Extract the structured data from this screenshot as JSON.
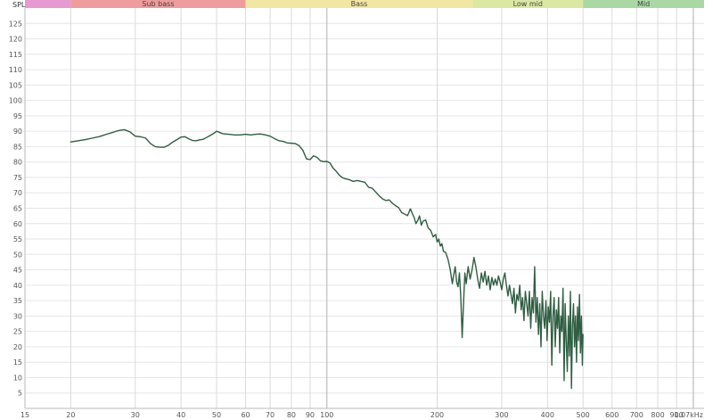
{
  "chart_data": {
    "type": "line",
    "y_axis_label": "SPL",
    "x_scale": "log",
    "xlim": [
      15,
      1070
    ],
    "ylim": [
      0,
      130
    ],
    "grid": true,
    "x_ticks": [
      {
        "value": 15,
        "label": "15"
      },
      {
        "value": 20,
        "label": "20"
      },
      {
        "value": 30,
        "label": "30"
      },
      {
        "value": 40,
        "label": "40"
      },
      {
        "value": 50,
        "label": "50"
      },
      {
        "value": 60,
        "label": "60"
      },
      {
        "value": 70,
        "label": "70"
      },
      {
        "value": 80,
        "label": "80"
      },
      {
        "value": 90,
        "label": "90"
      },
      {
        "value": 100,
        "label": "100"
      },
      {
        "value": 200,
        "label": "200"
      },
      {
        "value": 300,
        "label": "300"
      },
      {
        "value": 400,
        "label": "400"
      },
      {
        "value": 500,
        "label": "500"
      },
      {
        "value": 600,
        "label": "600"
      },
      {
        "value": 700,
        "label": "700"
      },
      {
        "value": 800,
        "label": "800"
      },
      {
        "value": 900,
        "label": "900"
      },
      {
        "value": 1070,
        "label": "1.07kHz"
      }
    ],
    "y_ticks": [
      5,
      10,
      15,
      20,
      25,
      30,
      35,
      40,
      45,
      50,
      55,
      60,
      65,
      70,
      75,
      80,
      85,
      90,
      95,
      100,
      105,
      110,
      115,
      120,
      125
    ],
    "bands": [
      {
        "label": "",
        "from": 15,
        "to": 20,
        "color": "#e79ad2"
      },
      {
        "label": "Sub bass",
        "from": 20,
        "to": 60,
        "color": "#ee9c9c"
      },
      {
        "label": "Bass",
        "from": 60,
        "to": 250,
        "color": "#f2e6a3"
      },
      {
        "label": "Low mid",
        "from": 250,
        "to": 500,
        "color": "#dbe8a3"
      },
      {
        "label": "Mid",
        "from": 500,
        "to": 1070,
        "color": "#a9d8a5"
      }
    ],
    "series": [
      {
        "line_color": "#2f5e42",
        "points": [
          [
            20,
            86.5
          ],
          [
            21,
            86.9
          ],
          [
            22,
            87.3
          ],
          [
            23,
            87.8
          ],
          [
            24,
            88.3
          ],
          [
            25,
            89.0
          ],
          [
            26,
            89.6
          ],
          [
            27,
            90.2
          ],
          [
            28,
            90.5
          ],
          [
            29,
            89.8
          ],
          [
            30,
            88.4
          ],
          [
            31,
            88.2
          ],
          [
            32,
            87.8
          ],
          [
            33,
            86.0
          ],
          [
            34,
            85.0
          ],
          [
            35,
            84.8
          ],
          [
            36,
            84.8
          ],
          [
            37,
            85.5
          ],
          [
            38,
            86.5
          ],
          [
            39,
            87.3
          ],
          [
            40,
            88.1
          ],
          [
            41,
            88.2
          ],
          [
            42,
            87.5
          ],
          [
            43,
            87.0
          ],
          [
            44,
            86.9
          ],
          [
            45,
            87.2
          ],
          [
            46,
            87.4
          ],
          [
            47,
            88.0
          ],
          [
            48,
            88.6
          ],
          [
            49,
            89.2
          ],
          [
            50,
            90.0
          ],
          [
            51,
            89.6
          ],
          [
            52,
            89.2
          ],
          [
            54,
            89.0
          ],
          [
            56,
            88.8
          ],
          [
            58,
            88.8
          ],
          [
            60,
            89.0
          ],
          [
            62,
            88.8
          ],
          [
            64,
            89.0
          ],
          [
            66,
            89.1
          ],
          [
            68,
            88.8
          ],
          [
            70,
            88.4
          ],
          [
            72,
            87.6
          ],
          [
            74,
            86.9
          ],
          [
            76,
            86.7
          ],
          [
            78,
            86.2
          ],
          [
            80,
            86.1
          ],
          [
            82,
            86.0
          ],
          [
            84,
            85.3
          ],
          [
            86,
            83.8
          ],
          [
            88,
            81.0
          ],
          [
            90,
            80.8
          ],
          [
            92,
            82.0
          ],
          [
            94,
            81.5
          ],
          [
            96,
            80.4
          ],
          [
            98,
            80.1
          ],
          [
            100,
            80.2
          ],
          [
            102,
            79.7
          ],
          [
            104,
            78.0
          ],
          [
            106,
            77.0
          ],
          [
            108,
            75.8
          ],
          [
            110,
            75.0
          ],
          [
            112,
            74.6
          ],
          [
            115,
            74.3
          ],
          [
            118,
            73.7
          ],
          [
            121,
            74.0
          ],
          [
            124,
            73.7
          ],
          [
            127,
            73.4
          ],
          [
            130,
            71.8
          ],
          [
            133,
            71.5
          ],
          [
            136,
            70.2
          ],
          [
            139,
            69.0
          ],
          [
            142,
            68.0
          ],
          [
            145,
            67.5
          ],
          [
            148,
            67.7
          ],
          [
            151,
            66.6
          ],
          [
            154,
            65.8
          ],
          [
            157,
            65.2
          ],
          [
            160,
            63.6
          ],
          [
            163,
            63.1
          ],
          [
            166,
            62.6
          ],
          [
            169,
            64.8
          ],
          [
            171,
            63.3
          ],
          [
            173,
            62.0
          ],
          [
            175,
            60.0
          ],
          [
            177,
            61.0
          ],
          [
            179,
            62.5
          ],
          [
            181,
            59.5
          ],
          [
            183,
            60.8
          ],
          [
            186,
            61.2
          ],
          [
            189,
            58.6
          ],
          [
            192,
            57.8
          ],
          [
            195,
            55.7
          ],
          [
            198,
            56.5
          ],
          [
            200,
            54.0
          ],
          [
            202,
            55.0
          ],
          [
            204,
            52.7
          ],
          [
            206,
            53.5
          ],
          [
            208,
            51.0
          ],
          [
            211,
            50.6
          ],
          [
            214,
            48.5
          ],
          [
            217,
            45.2
          ],
          [
            220,
            40.5
          ],
          [
            222,
            43.5
          ],
          [
            224,
            46.0
          ],
          [
            226,
            41.0
          ],
          [
            228,
            39.5
          ],
          [
            230,
            44.0
          ],
          [
            232,
            36.0
          ],
          [
            234,
            23.0
          ],
          [
            236,
            34.0
          ],
          [
            238,
            44.0
          ],
          [
            240,
            40.5
          ],
          [
            243,
            46.0
          ],
          [
            246,
            42.0
          ],
          [
            249,
            45.0
          ],
          [
            252,
            49.0
          ],
          [
            255,
            46.0
          ],
          [
            258,
            42.0
          ],
          [
            261,
            39.0
          ],
          [
            264,
            44.0
          ],
          [
            267,
            41.0
          ],
          [
            270,
            44.5
          ],
          [
            273,
            40.0
          ],
          [
            276,
            43.0
          ],
          [
            279,
            38.5
          ],
          [
            282,
            42.5
          ],
          [
            285,
            40.0
          ],
          [
            288,
            42.0
          ],
          [
            291,
            40.0
          ],
          [
            294,
            43.0
          ],
          [
            297,
            41.0
          ],
          [
            300,
            38.5
          ],
          [
            303,
            42.0
          ],
          [
            306,
            44.0
          ],
          [
            309,
            40.0
          ],
          [
            312,
            36.5
          ],
          [
            315,
            40.0
          ],
          [
            318,
            37.0
          ],
          [
            321,
            34.0
          ],
          [
            324,
            39.0
          ],
          [
            327,
            31.0
          ],
          [
            330,
            37.0
          ],
          [
            333,
            35.0
          ],
          [
            336,
            40.0
          ],
          [
            339,
            32.0
          ],
          [
            342,
            36.0
          ],
          [
            345,
            28.5
          ],
          [
            348,
            38.0
          ],
          [
            351,
            34.0
          ],
          [
            354,
            30.0
          ],
          [
            357,
            38.0
          ],
          [
            360,
            26.0
          ],
          [
            363,
            36.0
          ],
          [
            366,
            31.0
          ],
          [
            369,
            46.0
          ],
          [
            372,
            28.0
          ],
          [
            375,
            36.0
          ],
          [
            378,
            24.0
          ],
          [
            381,
            34.0
          ],
          [
            384,
            20.0
          ],
          [
            387,
            38.0
          ],
          [
            390,
            30.0
          ],
          [
            393,
            26.0
          ],
          [
            396,
            35.0
          ],
          [
            399,
            22.0
          ],
          [
            402,
            33.0
          ],
          [
            405,
            28.0
          ],
          [
            408,
            38.0
          ],
          [
            411,
            14.0
          ],
          [
            414,
            30.0
          ],
          [
            417,
            36.0
          ],
          [
            420,
            20.0
          ],
          [
            423,
            32.0
          ],
          [
            426,
            26.0
          ],
          [
            429,
            36.0
          ],
          [
            432,
            18.0
          ],
          [
            435,
            30.0
          ],
          [
            438,
            25.0
          ],
          [
            441,
            39.0
          ],
          [
            444,
            9.0
          ],
          [
            447,
            34.0
          ],
          [
            450,
            22.0
          ],
          [
            453,
            12.0
          ],
          [
            456,
            30.0
          ],
          [
            459,
            17.0
          ],
          [
            462,
            38.0
          ],
          [
            465,
            6.5
          ],
          [
            468,
            27.0
          ],
          [
            471,
            34.0
          ],
          [
            474,
            20.0
          ],
          [
            477,
            30.0
          ],
          [
            480,
            15.0
          ],
          [
            483,
            33.0
          ],
          [
            486,
            22.0
          ],
          [
            489,
            37.0
          ],
          [
            492,
            18.0
          ],
          [
            495,
            30.0
          ],
          [
            498,
            14.0
          ],
          [
            500,
            24.0
          ]
        ]
      }
    ]
  }
}
